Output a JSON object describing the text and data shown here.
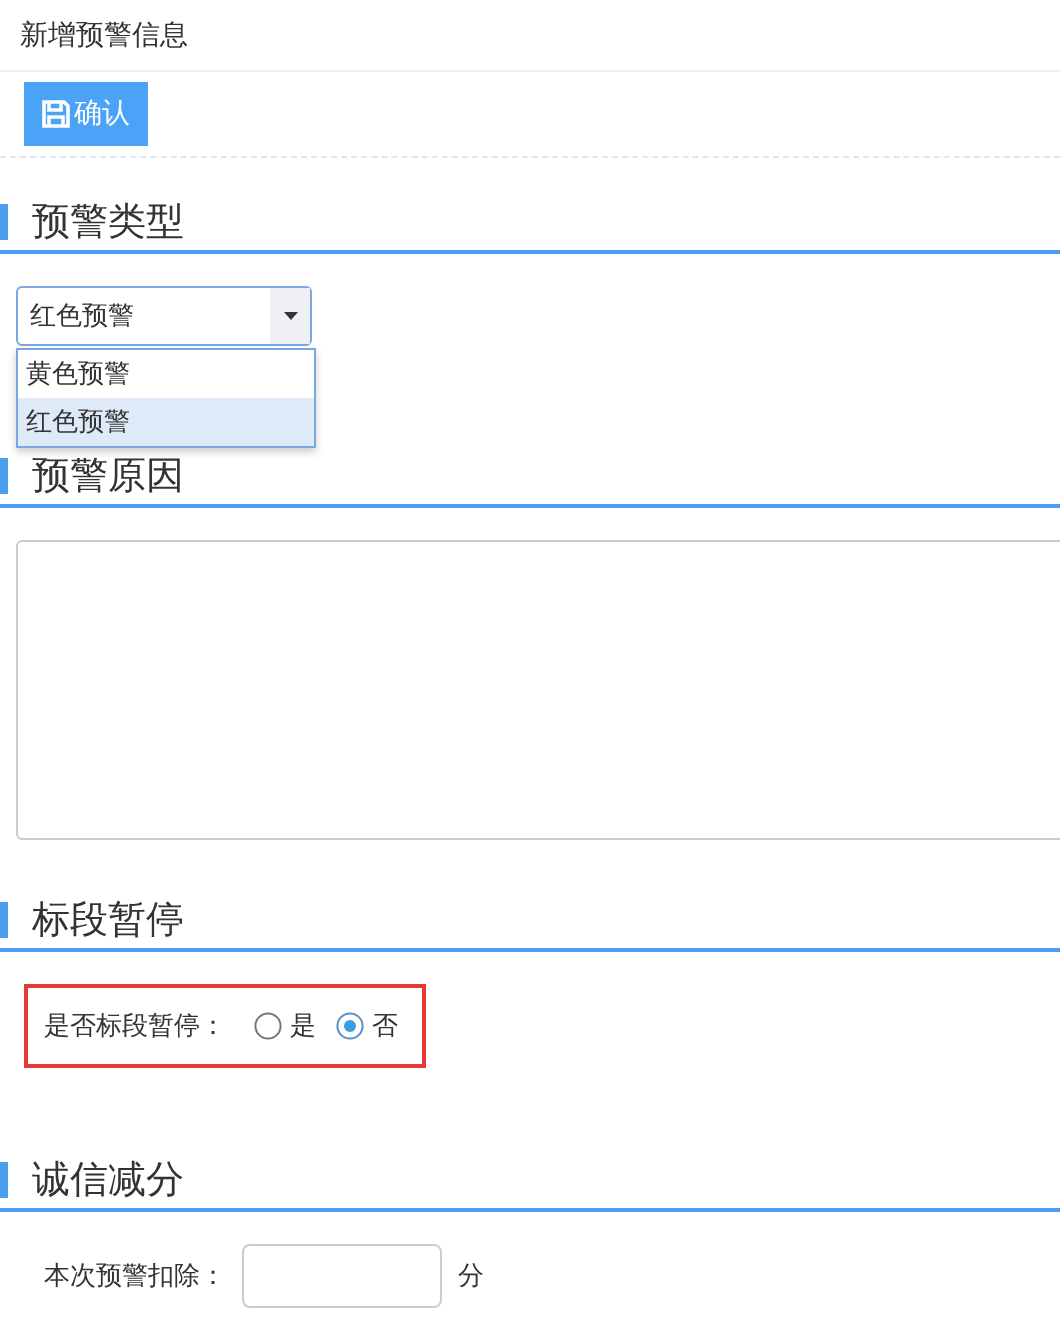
{
  "page_title": "新增预警信息",
  "toolbar": {
    "confirm_button": "确认"
  },
  "sections": [
    {
      "kind": "select",
      "title": "预警类型",
      "value": "红色预警",
      "expanded": true,
      "options": [
        {
          "label": "黄色预警",
          "selected": false
        },
        {
          "label": "红色预警",
          "selected": true
        }
      ]
    },
    {
      "kind": "textarea",
      "title": "预警原因"
    },
    {
      "kind": "radio",
      "title": "标段暂停",
      "label": "是否标段暂停：",
      "highlighted": true,
      "options": [
        {
          "label": "是",
          "selected": false
        },
        {
          "label": "否",
          "selected": true
        }
      ]
    },
    {
      "kind": "number",
      "title": "诚信减分",
      "label": "本次预警扣除：",
      "unit": "分"
    }
  ]
}
